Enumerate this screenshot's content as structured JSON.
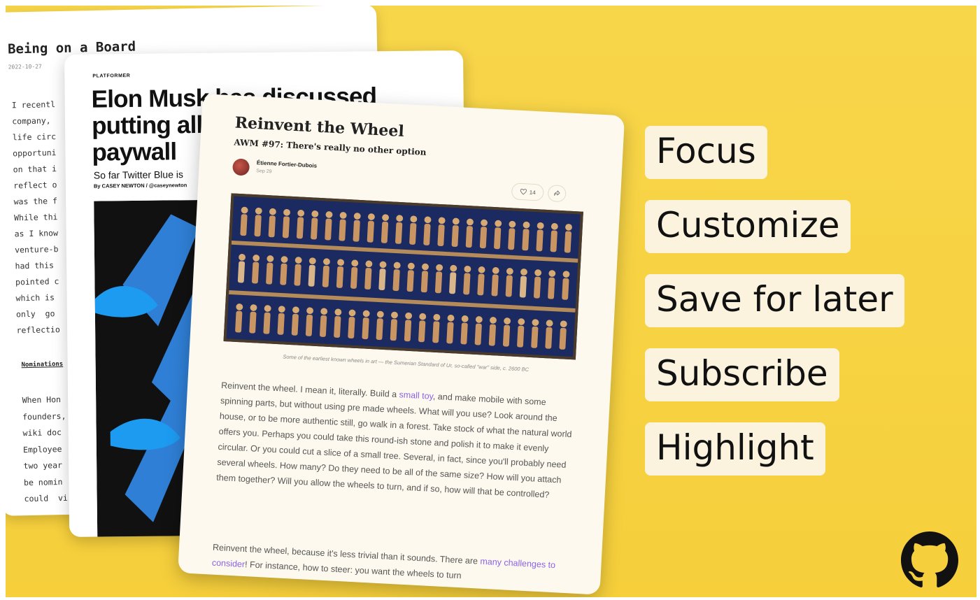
{
  "card_board": {
    "title": "Being on a Board",
    "date": "2022-10-27",
    "lines": [
      "I recentl",
      "company, ",
      "life circ",
      "opportuni",
      "on that i",
      "reflect o",
      "was the f",
      "While thi",
      "as I know",
      "venture-b",
      "had this ",
      "pointed c",
      "which is ",
      "only  go",
      "reflectio"
    ],
    "subheading": "Nominations",
    "lines2": [
      "When Hon",
      "founders,",
      "wiki doc",
      "Employee ",
      "two year",
      "be nomin",
      "could  vi"
    ]
  },
  "card_platformer": {
    "kicker": "PLATFORMER",
    "headline": "Elon Musk has discussed putting all of Twitter behind a paywall",
    "dek": "So far Twitter Blue is",
    "byline": "By CASEY NEWTON / @caseynewton"
  },
  "card_wheel": {
    "title": "Reinvent the Wheel",
    "subtitle": "AWM #97: There's really no other option",
    "author": "Étienne Fortier-Dubois",
    "date": "Sep 29",
    "likes": "14",
    "caption": "Some of the earliest known wheels in art — the Sumerian Standard of Ur, so-called \"war\" side, c. 2600 BC",
    "body_before_link": "Reinvent the wheel. I mean it, literally. Build a ",
    "body_link": "small toy",
    "body_after_link": ", and make mobile with some spinning parts, but without using pre made wheels. What will you use? Look around the house, or to be more authentic still, go walk in a forest. Take stock of what the natural world offers you. Perhaps you could take this round-ish stone and polish it to make it evenly circular. Or you could cut a slice of a small tree. Several, in fact, since you'll probably need several wheels. How many? Do they need to be all of the same size? How will you attach them together? Will you allow the wheels to turn, and if so, how will that be controlled?",
    "body2_before_link": "Reinvent the wheel, because it's less trivial than it sounds. There are ",
    "body2_link": "many challenges to consider",
    "body2_after_link": "! For instance, how to steer: you want the wheels to turn"
  },
  "features": [
    "Focus",
    "Customize",
    "Save for later",
    "Subscribe",
    "Highlight"
  ],
  "colors": {
    "background": "#f6cf3b",
    "feature_bg": "#fbf3de",
    "link": "#8a62e8",
    "twitter_blue": "#1d9bf0",
    "accent_magenta": "#d946ef"
  },
  "icons": {
    "github": "github-icon",
    "heart": "heart-icon",
    "share": "share-icon"
  }
}
